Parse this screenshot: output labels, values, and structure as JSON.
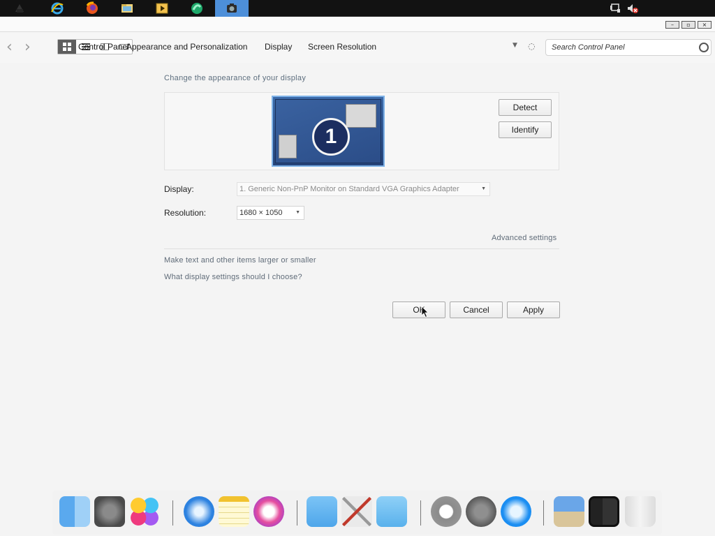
{
  "taskbar": {
    "apps": [
      "app-icon",
      "ie-icon",
      "firefox-icon",
      "file-explorer-icon",
      "media-player-icon",
      "browser-icon",
      "camera-icon"
    ],
    "tray": [
      "network-icon",
      "muted-volume-icon"
    ]
  },
  "window": {
    "controls": {
      "minimize": "–",
      "restore": "▫",
      "close": "×"
    }
  },
  "address_bar": {
    "breadcrumbs": [
      "Control Panel",
      "Appearance and Personalization",
      "Display",
      "Screen Resolution"
    ],
    "search_placeholder": "Search Control Panel"
  },
  "display_settings": {
    "heading": "Change the appearance of your display",
    "monitor_number": "1",
    "detect_label": "Detect",
    "identify_label": "Identify",
    "display_label": "Display:",
    "display_value": "1. Generic Non-PnP Monitor on Standard VGA Graphics Adapter",
    "resolution_label": "Resolution:",
    "resolution_value": "1680 × 1050",
    "advanced_link": "Advanced settings",
    "text_size_link": "Make text and other items larger or smaller",
    "help_link": "What display settings should I choose?",
    "ok_label": "OK",
    "cancel_label": "Cancel",
    "apply_label": "Apply"
  },
  "dock": {
    "items": [
      "finder-icon",
      "system-preferences-icon",
      "game-center-icon",
      "safari-icon",
      "notes-icon",
      "itunes-icon",
      "folder-icon",
      "x-tools-icon",
      "applications-folder-icon",
      "power-icon",
      "launchpad-icon",
      "app-store-icon",
      "preview-icon",
      "photo-booth-icon",
      "trash-icon"
    ]
  }
}
